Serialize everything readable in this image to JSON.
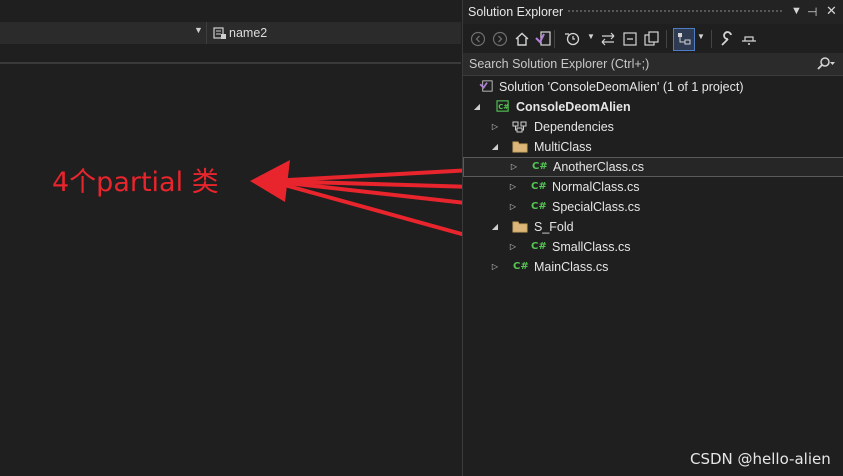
{
  "editor": {
    "member_dropdown": "name2"
  },
  "annotation": {
    "text": "4个partial 类",
    "color": "#e8242c"
  },
  "solution_explorer": {
    "title": "Solution Explorer",
    "search_placeholder": "Search Solution Explorer (Ctrl+;)",
    "solution_label": "Solution 'ConsoleDeomAlien' (1 of 1 project)",
    "project_label": "ConsoleDeomAlien",
    "items": [
      {
        "label": "Dependencies",
        "icon": "dependencies-icon"
      },
      {
        "label": "MultiClass",
        "icon": "folder-icon"
      },
      {
        "label": "AnotherClass.cs",
        "icon": "csharp-file-icon",
        "badge": "C#"
      },
      {
        "label": "NormalClass.cs",
        "icon": "csharp-file-icon",
        "badge": "C#"
      },
      {
        "label": "SpecialClass.cs",
        "icon": "csharp-file-icon",
        "badge": "C#"
      },
      {
        "label": "S_Fold",
        "icon": "folder-icon"
      },
      {
        "label": "SmallClass.cs",
        "icon": "csharp-file-icon",
        "badge": "C#"
      },
      {
        "label": "MainClass.cs",
        "icon": "csharp-file-icon",
        "badge": "C#"
      }
    ]
  },
  "watermark": "CSDN @hello-alien"
}
